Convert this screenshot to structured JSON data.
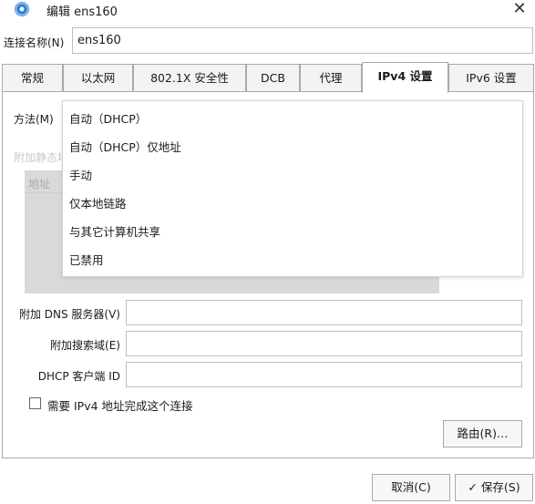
{
  "window": {
    "title": "编辑 ens160",
    "close_glyph": "✕",
    "icon": "network-settings-icon"
  },
  "connection": {
    "label": "连接名称(N)",
    "value": "ens160"
  },
  "tabs": [
    {
      "label": "常规"
    },
    {
      "label": "以太网"
    },
    {
      "label": "802.1X 安全性"
    },
    {
      "label": "DCB"
    },
    {
      "label": "代理"
    },
    {
      "label": "IPv4 设置"
    },
    {
      "label": "IPv6 设置"
    }
  ],
  "active_tab": "IPv4 设置",
  "ipv4": {
    "method_label": "方法(M)",
    "method_options": [
      "自动（DHCP）",
      "自动（DHCP）仅地址",
      "手动",
      "仅本地链路",
      "与其它计算机共享",
      "已禁用"
    ],
    "static_label": "附加静态地",
    "address_column": "地址",
    "dns_label": "附加 DNS 服务器(V)",
    "dns_value": "",
    "search_label": "附加搜索域(E)",
    "search_value": "",
    "dhcp_label": "DHCP 客户端 ID",
    "dhcp_value": "",
    "require_label": "需要 IPv4 地址完成这个连接",
    "require_checked": false,
    "routes_button": "路由(R)…"
  },
  "footer": {
    "cancel": "取消(C)",
    "save": "保存(S)",
    "save_icon": "check-icon",
    "check_glyph": "✓"
  }
}
